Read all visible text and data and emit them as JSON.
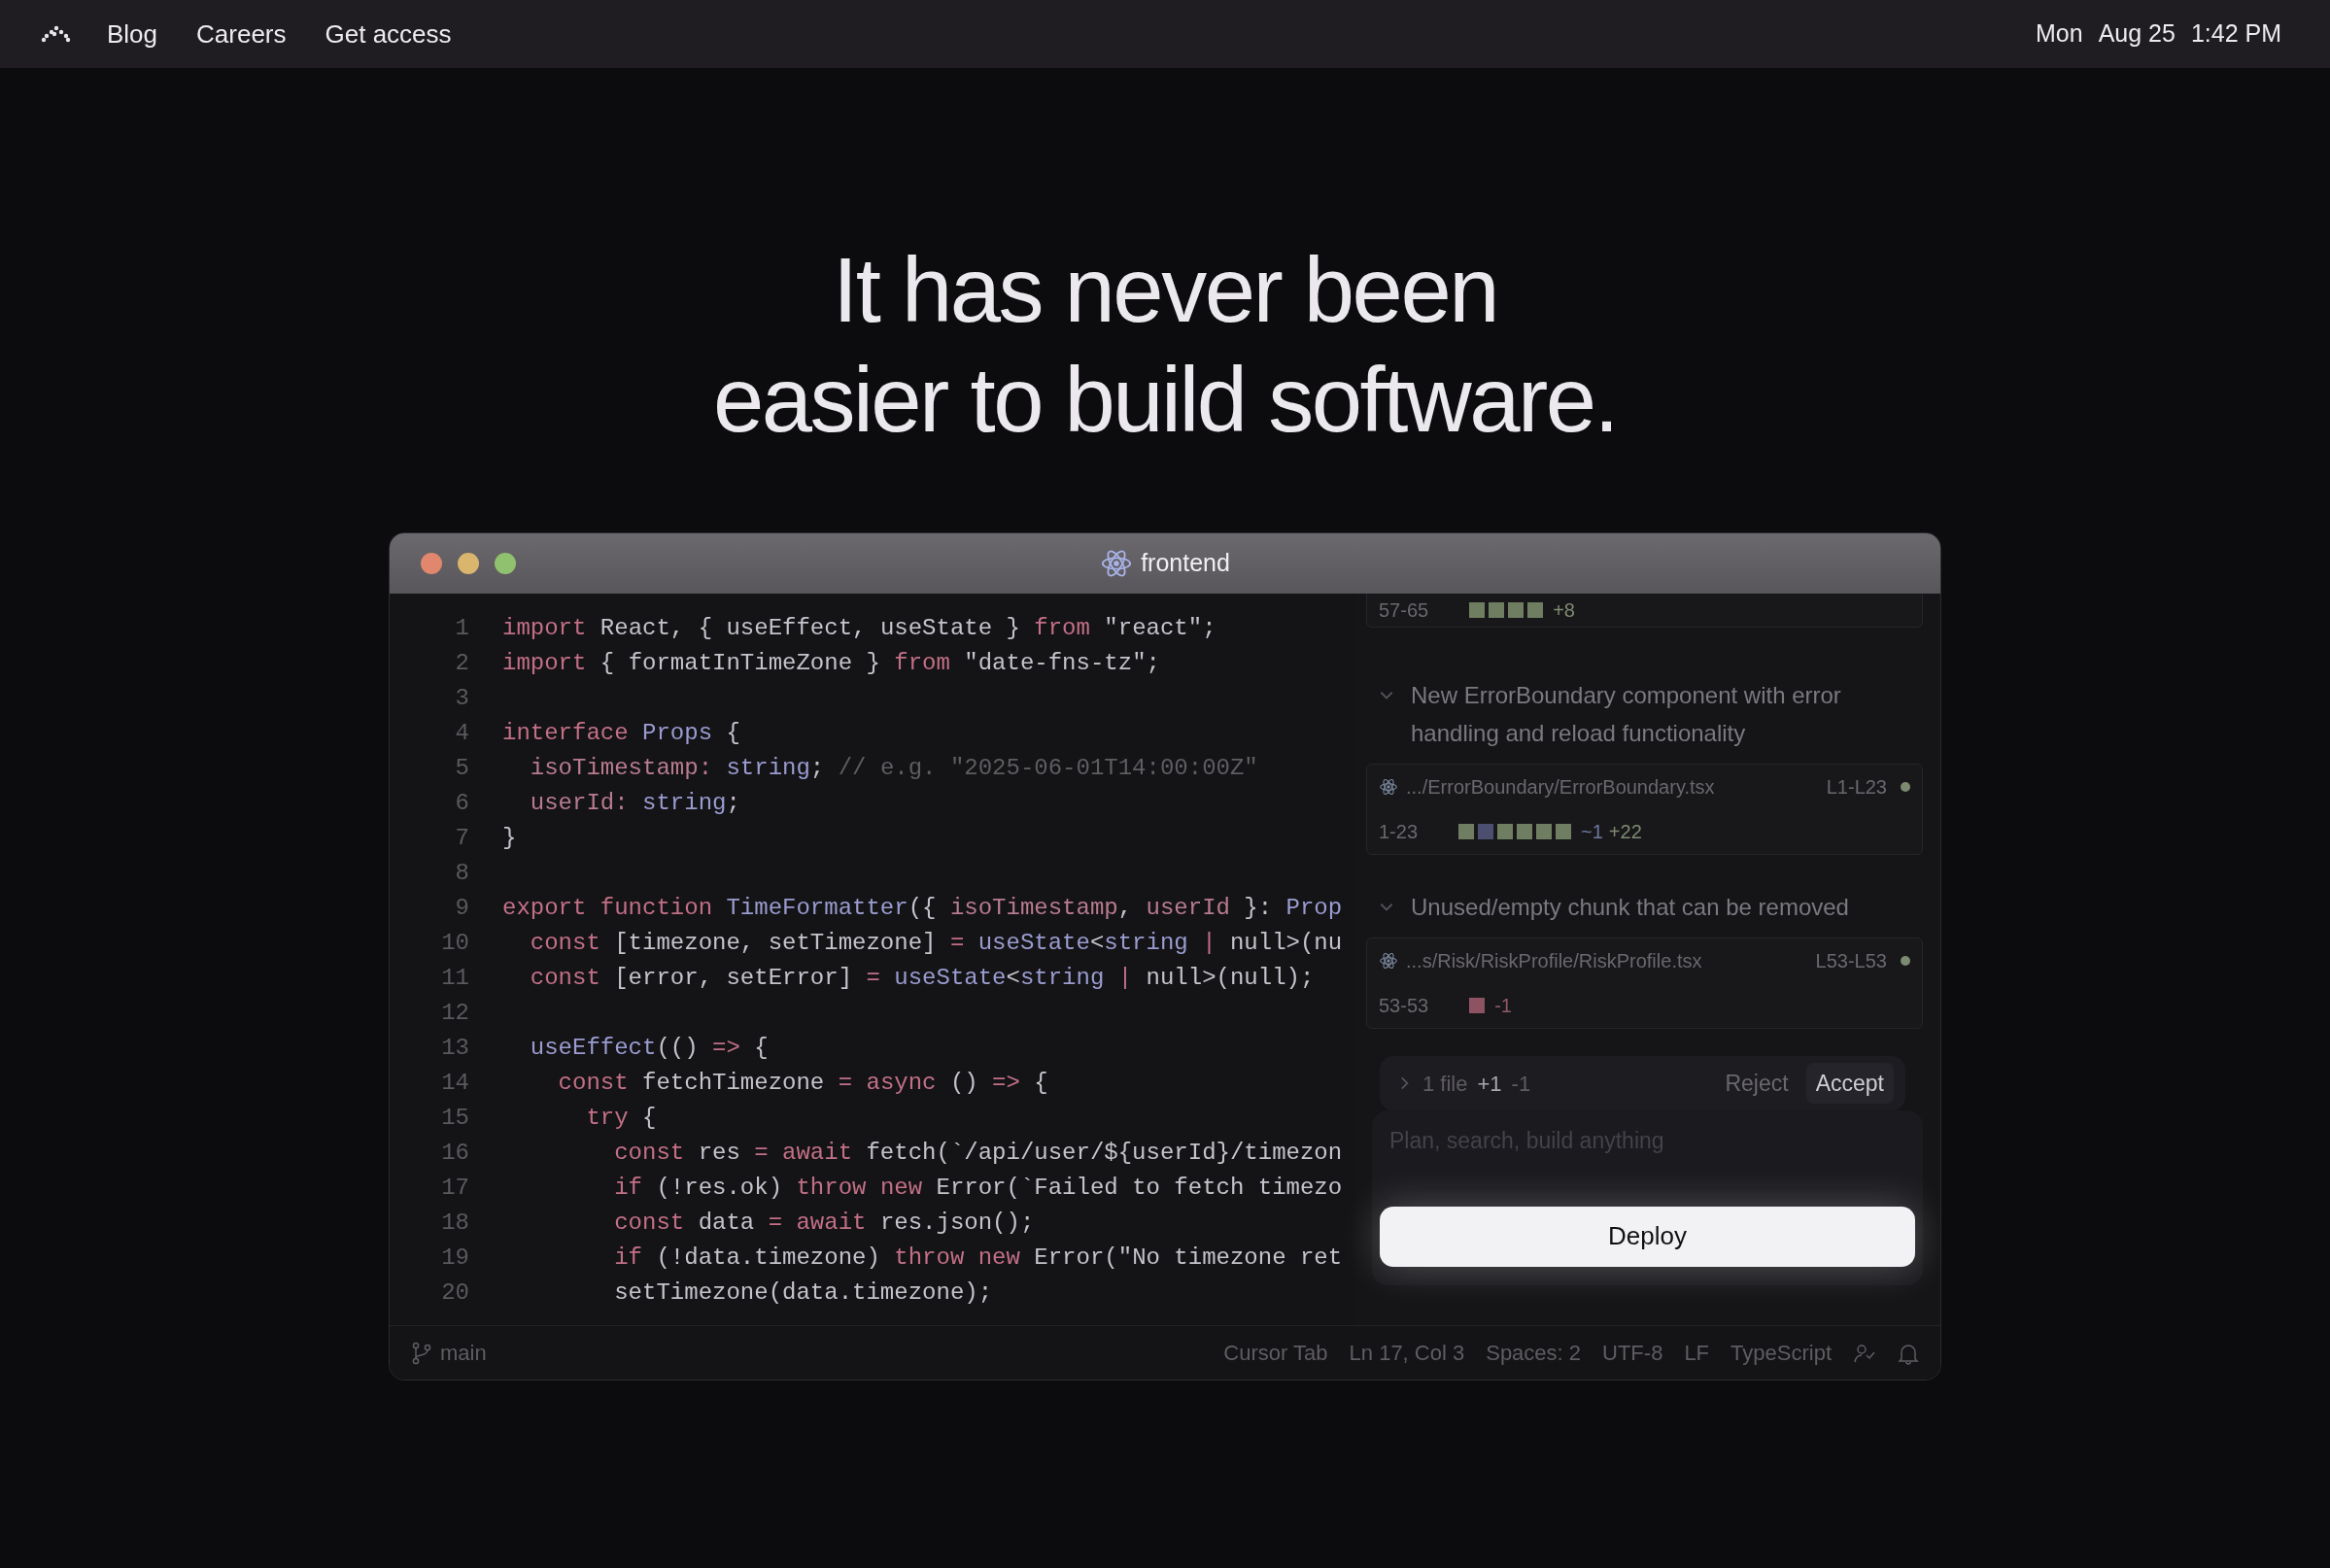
{
  "nav": {
    "links": [
      "Blog",
      "Careers",
      "Get access"
    ],
    "clock": [
      "Mon",
      "Aug 25",
      "1:42 PM"
    ]
  },
  "headline": [
    "It has never been",
    "easier to build software."
  ],
  "window": {
    "title": "frontend"
  },
  "code": {
    "lines": [
      {
        "number": "1",
        "tokens": [
          {
            "kind": "keyword",
            "text": "import "
          },
          {
            "kind": "plain",
            "text": "React, { useEffect, useState } "
          },
          {
            "kind": "keyword",
            "text": "from "
          },
          {
            "kind": "plain",
            "text": "\"react\";"
          }
        ]
      },
      {
        "number": "2",
        "tokens": [
          {
            "kind": "keyword",
            "text": "import "
          },
          {
            "kind": "plain",
            "text": "{ formatInTimeZone } "
          },
          {
            "kind": "keyword",
            "text": "from "
          },
          {
            "kind": "plain",
            "text": "\"date-fns-tz\";"
          }
        ]
      },
      {
        "number": "3"
      },
      {
        "number": "4",
        "tokens": [
          {
            "kind": "keyword",
            "text": "interface "
          },
          {
            "kind": "function",
            "text": "Props "
          },
          {
            "kind": "plain",
            "text": "{"
          }
        ]
      },
      {
        "number": "5",
        "tokens": [
          {
            "kind": "property",
            "text": "  isoTimestamp: "
          },
          {
            "kind": "function",
            "text": "string"
          },
          {
            "kind": "plain",
            "text": "; "
          },
          {
            "kind": "comment",
            "text": "// e.g. \"2025-06-01T14:00:00Z\""
          }
        ]
      },
      {
        "number": "6",
        "tokens": [
          {
            "kind": "property",
            "text": "  userId: "
          },
          {
            "kind": "function",
            "text": "string"
          },
          {
            "kind": "plain",
            "text": ";"
          }
        ]
      },
      {
        "number": "7",
        "tokens": [
          {
            "kind": "plain",
            "text": "}"
          }
        ]
      },
      {
        "number": "8"
      },
      {
        "number": "9",
        "tokens": [
          {
            "kind": "keyword",
            "text": "export function "
          },
          {
            "kind": "function",
            "text": "TimeFormatter"
          },
          {
            "kind": "plain",
            "text": "({ "
          },
          {
            "kind": "property",
            "text": "isoTimestamp"
          },
          {
            "kind": "plain",
            "text": ", "
          },
          {
            "kind": "property",
            "text": "userId"
          },
          {
            "kind": "plain",
            "text": " }: "
          },
          {
            "kind": "function",
            "text": "Prop"
          }
        ]
      },
      {
        "number": "10",
        "tokens": [
          {
            "kind": "keyword",
            "text": "  const "
          },
          {
            "kind": "plain",
            "text": "[timezone, setTimezone] "
          },
          {
            "kind": "keyword",
            "text": "= "
          },
          {
            "kind": "function",
            "text": "useState"
          },
          {
            "kind": "plain",
            "text": "<"
          },
          {
            "kind": "function",
            "text": "string "
          },
          {
            "kind": "keyword",
            "text": "| "
          },
          {
            "kind": "plain",
            "text": "null>(nu"
          }
        ]
      },
      {
        "number": "11",
        "tokens": [
          {
            "kind": "keyword",
            "text": "  const "
          },
          {
            "kind": "plain",
            "text": "[error, setError] "
          },
          {
            "kind": "keyword",
            "text": "= "
          },
          {
            "kind": "function",
            "text": "useState"
          },
          {
            "kind": "plain",
            "text": "<"
          },
          {
            "kind": "function",
            "text": "string "
          },
          {
            "kind": "keyword",
            "text": "| "
          },
          {
            "kind": "plain",
            "text": "null>(null);"
          }
        ]
      },
      {
        "number": "12"
      },
      {
        "number": "13",
        "tokens": [
          {
            "kind": "function",
            "text": "  useEffect"
          },
          {
            "kind": "plain",
            "text": "(() "
          },
          {
            "kind": "keyword",
            "text": "=> "
          },
          {
            "kind": "plain",
            "text": "{"
          }
        ]
      },
      {
        "number": "14",
        "tokens": [
          {
            "kind": "keyword",
            "text": "    const "
          },
          {
            "kind": "plain",
            "text": "fetchTimezone "
          },
          {
            "kind": "keyword",
            "text": "= async "
          },
          {
            "kind": "plain",
            "text": "() "
          },
          {
            "kind": "keyword",
            "text": "=> "
          },
          {
            "kind": "plain",
            "text": "{"
          }
        ]
      },
      {
        "number": "15",
        "tokens": [
          {
            "kind": "keyword",
            "text": "      try "
          },
          {
            "kind": "plain",
            "text": "{"
          }
        ]
      },
      {
        "number": "16",
        "tokens": [
          {
            "kind": "keyword",
            "text": "        const "
          },
          {
            "kind": "plain",
            "text": "res "
          },
          {
            "kind": "keyword",
            "text": "= await "
          },
          {
            "kind": "plain",
            "text": "fetch(`/api/user/${userId}/timezon"
          }
        ]
      },
      {
        "number": "17",
        "tokens": [
          {
            "kind": "keyword",
            "text": "        if "
          },
          {
            "kind": "plain",
            "text": "(!res.ok) "
          },
          {
            "kind": "keyword",
            "text": "throw new "
          },
          {
            "kind": "plain",
            "text": "Error(`Failed to fetch timezo"
          }
        ]
      },
      {
        "number": "18",
        "tokens": [
          {
            "kind": "keyword",
            "text": "        const "
          },
          {
            "kind": "plain",
            "text": "data "
          },
          {
            "kind": "keyword",
            "text": "= await "
          },
          {
            "kind": "plain",
            "text": "res.json();"
          }
        ]
      },
      {
        "number": "19",
        "tokens": [
          {
            "kind": "keyword",
            "text": "        if "
          },
          {
            "kind": "plain",
            "text": "(!data.timezone) "
          },
          {
            "kind": "keyword",
            "text": "throw new "
          },
          {
            "kind": "plain",
            "text": "Error(\"No timezone ret"
          }
        ]
      },
      {
        "number": "20",
        "tokens": [
          {
            "kind": "plain",
            "text": "        setTimezone(data.timezone);"
          }
        ]
      }
    ]
  },
  "review": {
    "top_chunk": {
      "range": "57-65",
      "blocks": [
        {
          "kind": "added"
        },
        {
          "kind": "added"
        },
        {
          "kind": "added"
        },
        {
          "kind": "added"
        }
      ],
      "stats": [
        {
          "kind": "added",
          "text": "+8"
        }
      ]
    },
    "groups": [
      {
        "title": "New ErrorBoundary component with error handling and reload functionality",
        "expanded": true,
        "file": {
          "path": ".../ErrorBoundary/ErrorBoundary.tsx",
          "lines": "L1-L23"
        },
        "chunk": {
          "range": "1-23",
          "blocks": [
            {
              "kind": "added"
            },
            {
              "kind": "changed"
            },
            {
              "kind": "added"
            },
            {
              "kind": "added"
            },
            {
              "kind": "added"
            },
            {
              "kind": "added"
            }
          ],
          "stats": [
            {
              "kind": "changed",
              "text": "~1"
            },
            {
              "kind": "added",
              "text": "+22"
            }
          ]
        }
      },
      {
        "title": "Unused/empty chunk that can be removed",
        "expanded": true,
        "file": {
          "path": "...s/Risk/RiskProfile/RiskProfile.tsx",
          "lines": "L53-L53"
        },
        "chunk": {
          "range": "53-53",
          "blocks": [
            {
              "kind": "removed"
            }
          ],
          "stats": [
            {
              "kind": "removed",
              "text": "-1"
            }
          ]
        }
      }
    ]
  },
  "pending": {
    "expanded": false,
    "summary": "1 file",
    "added": "+1",
    "removed": "-1",
    "buttons": [
      "Reject",
      "Accept"
    ]
  },
  "composer": {
    "placeholder": "Plan, search, build anything",
    "button": "Deploy"
  },
  "status_bar": {
    "branch": "main",
    "items": [
      "Cursor Tab",
      "Ln 17, Col 3",
      "Spaces: 2",
      "UTF-8",
      "LF",
      "TypeScript"
    ]
  }
}
